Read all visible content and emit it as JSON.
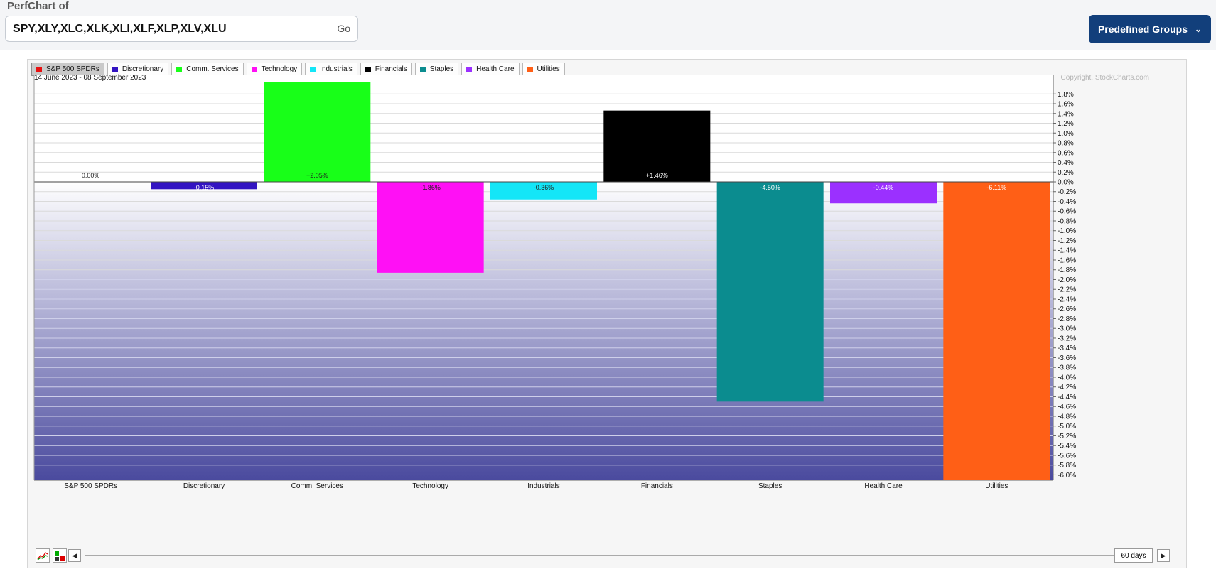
{
  "header": {
    "title": "PerfChart of",
    "symbols_value": "SPY,XLY,XLC,XLK,XLI,XLF,XLP,XLV,XLU",
    "go_label": "Go",
    "predefined_label": "Predefined Groups"
  },
  "legend": [
    {
      "label": "S&P 500 SPDRs",
      "color": "#e81010",
      "active": true
    },
    {
      "label": "Discretionary",
      "color": "#3314c2",
      "active": false
    },
    {
      "label": "Comm. Services",
      "color": "#18ff18",
      "active": false
    },
    {
      "label": "Technology",
      "color": "#ff10f5",
      "active": false
    },
    {
      "label": "Industrials",
      "color": "#14e6f7",
      "active": false
    },
    {
      "label": "Financials",
      "color": "#000000",
      "active": false
    },
    {
      "label": "Staples",
      "color": "#0b8c8f",
      "active": false
    },
    {
      "label": "Health Care",
      "color": "#9b30ff",
      "active": false
    },
    {
      "label": "Utilities",
      "color": "#ff5f16",
      "active": false
    }
  ],
  "chart_data": {
    "type": "bar",
    "date_range": "14 June 2023 - 08 September 2023",
    "copyright": "Copyright, StockCharts.com",
    "categories": [
      "S&P 500 SPDRs",
      "Discretionary",
      "Comm. Services",
      "Technology",
      "Industrials",
      "Financials",
      "Staples",
      "Health Care",
      "Utilities"
    ],
    "values": [
      0.0,
      -0.15,
      2.05,
      -1.86,
      -0.36,
      1.46,
      -4.5,
      -0.44,
      -6.11
    ],
    "value_labels": [
      "0.00%",
      "-0.15%",
      "+2.05%",
      "-1.86%",
      "-0.36%",
      "+1.46%",
      "-4.50%",
      "-0.44%",
      "-6.11%"
    ],
    "colors": [
      "#e81010",
      "#3314c2",
      "#18ff18",
      "#ff10f5",
      "#14e6f7",
      "#000000",
      "#0b8c8f",
      "#9b30ff",
      "#ff5f16"
    ],
    "ylim": [
      -6.11,
      2.05
    ],
    "yticks": [
      1.8,
      1.6,
      1.4,
      1.2,
      1.0,
      0.8,
      0.6,
      0.4,
      0.2,
      0.0,
      -0.2,
      -0.4,
      -0.6,
      -0.8,
      -1.0,
      -1.2,
      -1.4,
      -1.6,
      -1.8,
      -2.0,
      -2.2,
      -2.4,
      -2.6,
      -2.8,
      -3.0,
      -3.2,
      -3.4,
      -3.6,
      -3.8,
      -4.0,
      -4.2,
      -4.4,
      -4.6,
      -4.8,
      -5.0,
      -5.2,
      -5.4,
      -5.6,
      -5.8,
      -6.0
    ],
    "ytick_labels": [
      "1.8%",
      "1.6%",
      "1.4%",
      "1.2%",
      "1.0%",
      "0.8%",
      "0.6%",
      "0.4%",
      "0.2%",
      "0.0%",
      "-0.2%",
      "-0.4%",
      "-0.6%",
      "-0.8%",
      "-1.0%",
      "-1.2%",
      "-1.4%",
      "-1.6%",
      "-1.8%",
      "-2.0%",
      "-2.2%",
      "-2.4%",
      "-2.6%",
      "-2.8%",
      "-3.0%",
      "-3.2%",
      "-3.4%",
      "-3.6%",
      "-3.8%",
      "-4.0%",
      "-4.2%",
      "-4.4%",
      "-4.6%",
      "-4.8%",
      "-5.0%",
      "-5.2%",
      "-5.4%",
      "-5.6%",
      "-5.8%",
      "-6.0%"
    ],
    "axis_side": "right",
    "grid": true,
    "legend_placement": "top-left"
  },
  "controls": {
    "period_label": "60 days",
    "prev_arrow": "◀",
    "next_arrow": "▶"
  }
}
